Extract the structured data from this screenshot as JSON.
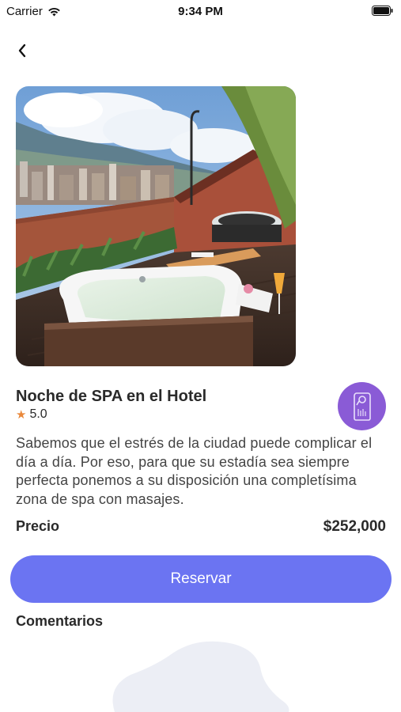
{
  "status_bar": {
    "carrier": "Carrier",
    "time": "9:34 PM",
    "icons": [
      "wifi-icon",
      "battery-icon"
    ]
  },
  "nav": {
    "back_icon": "chevron-left-icon"
  },
  "hero": {
    "image": "hotel rooftop jacuzzi photo"
  },
  "offer": {
    "title": "Noche de SPA en el Hotel",
    "rating": "5.0",
    "rating_icon": "star-icon",
    "badge_icon": "door-hanger-icon",
    "description": "Sabemos que el estrés de la ciudad puede complicar el día a día. Por eso, para que su estadía sea siempre perfecta ponemos a su disposición una completísima zona de spa con masajes.",
    "price_label": "Precio",
    "price_value": "$252,000"
  },
  "actions": {
    "reserve_label": "Reservar"
  },
  "comments": {
    "heading": "Comentarios"
  },
  "colors": {
    "accent": "#6b74f2",
    "badge": "#8a5bd6",
    "star": "#e9883a"
  }
}
